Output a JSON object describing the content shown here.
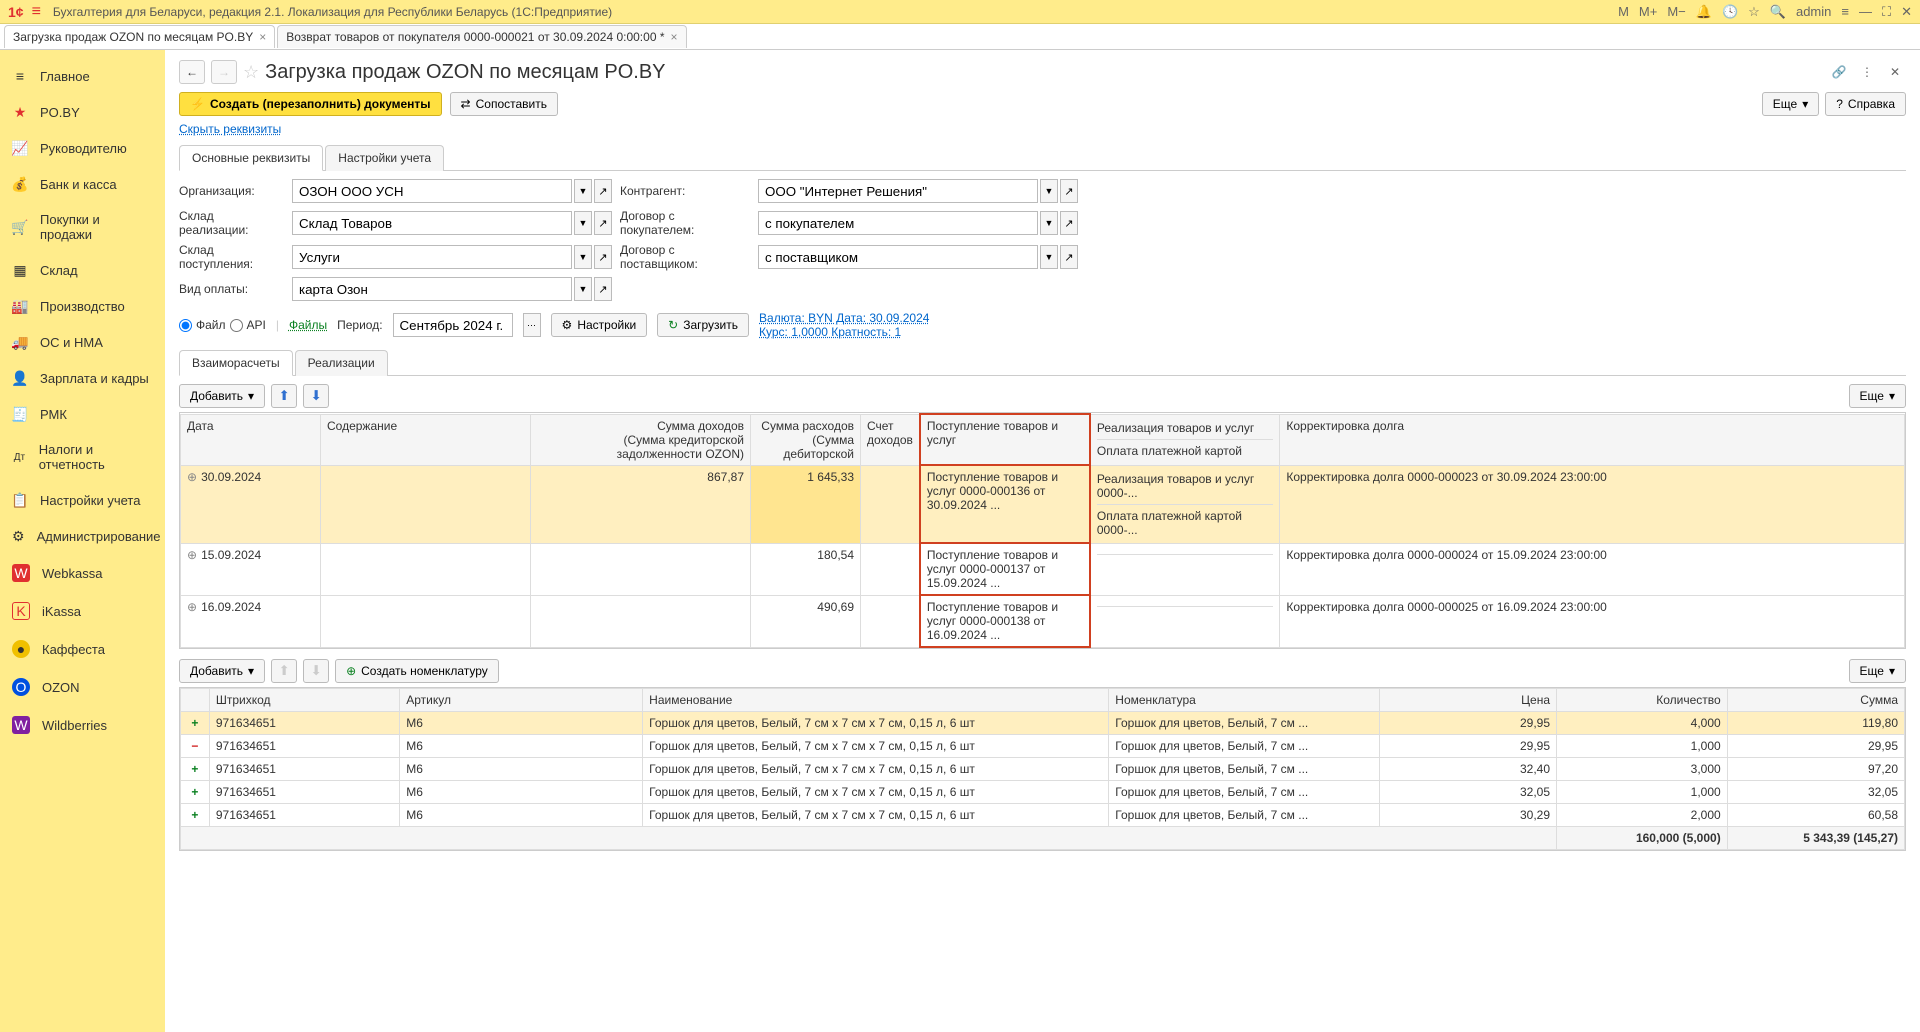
{
  "app": {
    "title": "Бухгалтерия для Беларуси, редакция 2.1. Локализация для Республики Беларусь  (1С:Предприятие)",
    "user": "admin",
    "mem_buttons": [
      "M",
      "M+",
      "M−"
    ]
  },
  "tabs": [
    {
      "label": "Загрузка продаж OZON по месяцам PO.BY",
      "active": true
    },
    {
      "label": "Возврат товаров от покупателя 0000-000021 от 30.09.2024 0:00:00 *",
      "active": false
    }
  ],
  "sidebar": [
    {
      "icon": "≡",
      "label": "Главное"
    },
    {
      "icon": "★",
      "label": "PO.BY"
    },
    {
      "icon": "📈",
      "label": "Руководителю"
    },
    {
      "icon": "💰",
      "label": "Банк и касса"
    },
    {
      "icon": "🛒",
      "label": "Покупки и продажи"
    },
    {
      "icon": "▦",
      "label": "Склад"
    },
    {
      "icon": "🏭",
      "label": "Производство"
    },
    {
      "icon": "🚚",
      "label": "ОС и НМА"
    },
    {
      "icon": "👤",
      "label": "Зарплата и кадры"
    },
    {
      "icon": "🧾",
      "label": "РМК"
    },
    {
      "icon": "Дт",
      "label": "Налоги и отчетность"
    },
    {
      "icon": "📋",
      "label": "Настройки учета"
    },
    {
      "icon": "⚙",
      "label": "Администрирование"
    },
    {
      "icon": "W",
      "label": "Webkassa"
    },
    {
      "icon": "K",
      "label": "iKassa"
    },
    {
      "icon": "●",
      "label": "Каффеста"
    },
    {
      "icon": "O",
      "label": "OZON"
    },
    {
      "icon": "W",
      "label": "Wildberries"
    }
  ],
  "page": {
    "title": "Загрузка продаж OZON по месяцам PO.BY",
    "btn_create": "Создать (перезаполнить) документы",
    "btn_compare": "Сопоставить",
    "btn_more": "Еще",
    "btn_help": "Справка",
    "hide_link": "Скрыть реквизиты"
  },
  "req_tabs": {
    "main": "Основные реквизиты",
    "settings": "Настройки учета"
  },
  "form": {
    "org_label": "Организация:",
    "org_value": "ОЗОН ООО УСН",
    "sklad_real_label": "Склад реализации:",
    "sklad_real_value": "Склад Товаров",
    "sklad_post_label": "Склад поступления:",
    "sklad_post_value": "Услуги",
    "vid_label": "Вид оплаты:",
    "vid_value": "карта Озон",
    "kontr_label": "Контрагент:",
    "kontr_value": "ООО \"Интернет Решения\"",
    "dog_pok_label": "Договор с покупателем:",
    "dog_pok_value": "с покупателем",
    "dog_post_label": "Договор с поставщиком:",
    "dog_post_value": "с поставщиком"
  },
  "period": {
    "file": "Файл",
    "api": "API",
    "files_link": "Файлы",
    "period_label": "Период:",
    "period_value": "Сентябрь 2024 г.",
    "btn_settings": "Настройки",
    "btn_load": "Загрузить",
    "currency_link": "Валюта: BYN Дата: 30.09.2024",
    "rate_link": "Курс: 1,0000 Кратность: 1"
  },
  "doc_tabs": {
    "settle": "Взаиморасчеты",
    "real": "Реализации"
  },
  "toolbar": {
    "add": "Добавить",
    "more": "Еще",
    "create_nom": "Создать номенклатуру"
  },
  "top_table": {
    "headers": {
      "date": "Дата",
      "content": "Содержание",
      "income": "Сумма доходов",
      "income_sub": "(Сумма кредиторской задолженности OZON)",
      "expense": "Сумма расходов",
      "expense_sub": "(Сумма дебиторской",
      "account": "Счет доходов",
      "post": "Поступление товаров и услуг",
      "real": "Реализация товаров и услуг",
      "real_sub": "Оплата платежной картой",
      "corr": "Корректировка долга"
    },
    "rows": [
      {
        "date": "30.09.2024",
        "income": "867,87",
        "expense": "1 645,33",
        "post": "Поступление товаров и услуг 0000-000136 от 30.09.2024 ...",
        "real": "Реализация товаров и услуг 0000-...",
        "real2": "Оплата платежной картой 0000-...",
        "corr": "Корректировка долга 0000-000023 от 30.09.2024 23:00:00",
        "sel": true
      },
      {
        "date": "15.09.2024",
        "income": "",
        "expense": "180,54",
        "post": "Поступление товаров и услуг 0000-000137 от 15.09.2024 ...",
        "real": "",
        "real2": "",
        "corr": "Корректировка долга 0000-000024 от 15.09.2024 23:00:00"
      },
      {
        "date": "16.09.2024",
        "income": "",
        "expense": "490,69",
        "post": "Поступление товаров и услуг 0000-000138 от 16.09.2024 ...",
        "real": "",
        "real2": "",
        "corr": "Корректировка долга 0000-000025 от 16.09.2024 23:00:00"
      }
    ]
  },
  "bottom_table": {
    "headers": {
      "barcode": "Штрихкод",
      "art": "Артикул",
      "name": "Наименование",
      "nom": "Номенклатура",
      "price": "Цена",
      "qty": "Количество",
      "sum": "Сумма"
    },
    "rows": [
      {
        "sign": "+",
        "barcode": "971634651",
        "art": "M6",
        "name": "Горшок для цветов, Белый, 7 см x 7 см x 7 см, 0,15 л, 6 шт",
        "nom": "Горшок для цветов, Белый, 7 см ...",
        "price": "29,95",
        "qty": "4,000",
        "sum": "119,80",
        "sel": true
      },
      {
        "sign": "−",
        "barcode": "971634651",
        "art": "M6",
        "name": "Горшок для цветов, Белый, 7 см x 7 см x 7 см, 0,15 л, 6 шт",
        "nom": "Горшок для цветов, Белый, 7 см ...",
        "price": "29,95",
        "qty": "1,000",
        "sum": "29,95"
      },
      {
        "sign": "+",
        "barcode": "971634651",
        "art": "M6",
        "name": "Горшок для цветов, Белый, 7 см x 7 см x 7 см, 0,15 л, 6 шт",
        "nom": "Горшок для цветов, Белый, 7 см ...",
        "price": "32,40",
        "qty": "3,000",
        "sum": "97,20"
      },
      {
        "sign": "+",
        "barcode": "971634651",
        "art": "M6",
        "name": "Горшок для цветов, Белый, 7 см x 7 см x 7 см, 0,15 л, 6 шт",
        "nom": "Горшок для цветов, Белый, 7 см ...",
        "price": "32,05",
        "qty": "1,000",
        "sum": "32,05"
      },
      {
        "sign": "+",
        "barcode": "971634651",
        "art": "M6",
        "name": "Горшок для цветов, Белый, 7 см x 7 см x 7 см, 0,15 л, 6 шт",
        "nom": "Горшок для цветов, Белый, 7 см ...",
        "price": "30,29",
        "qty": "2,000",
        "sum": "60,58"
      }
    ],
    "footer": {
      "qty": "160,000 (5,000)",
      "sum": "5 343,39 (145,27)"
    }
  }
}
